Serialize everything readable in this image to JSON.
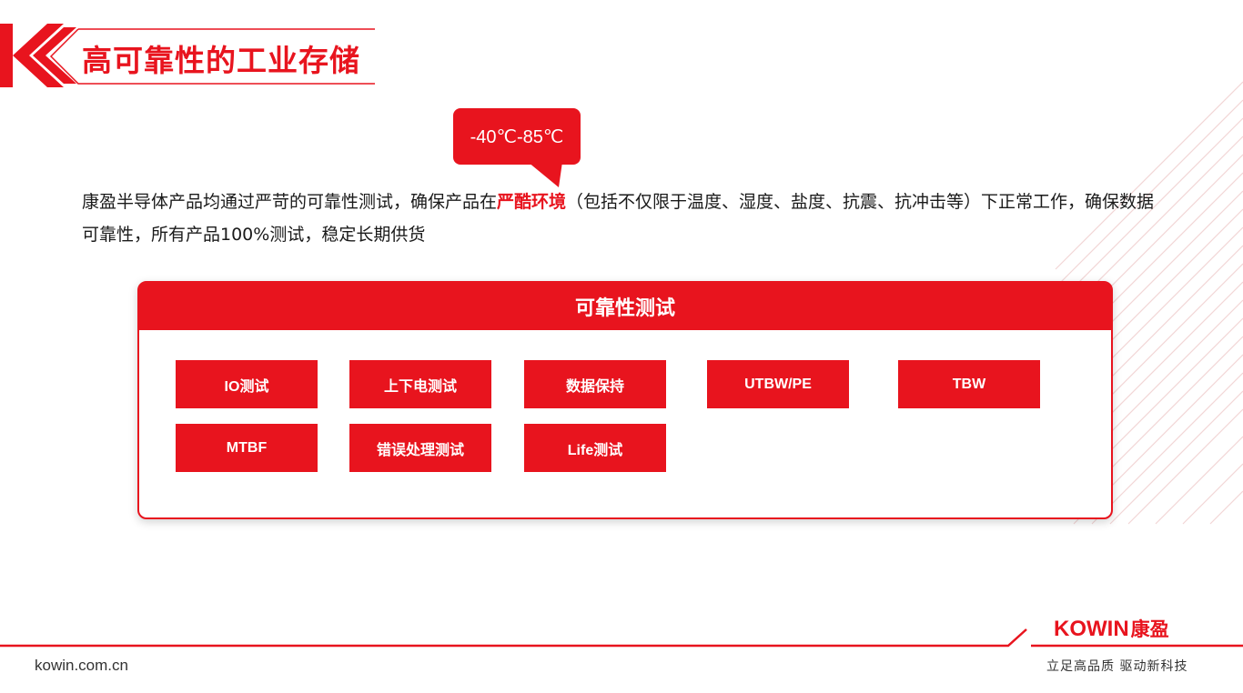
{
  "header": {
    "title": "高可靠性的工业存储"
  },
  "callout": {
    "text": "-40℃-85℃"
  },
  "intro": {
    "before": "康盈半导体产品均通过严苛的可靠性测试，确保产品在",
    "highlight": "严酷环境",
    "after": "（包括不仅限于温度、湿度、盐度、抗震、抗冲击等）下正常工作，确保数据可靠性，所有产品100%测试，稳定长期供货"
  },
  "panel": {
    "title": "可靠性测试",
    "tests": [
      "IO测试",
      "上下电测试",
      "数据保持",
      "UTBW/PE",
      "TBW",
      "MTBF",
      "错误处理测试",
      "Life测试"
    ]
  },
  "footer": {
    "brand_name": "KOWIN",
    "brand_cn": "康盈",
    "website": "kowin.com.cn",
    "slogan": "立足高品质 驱动新科技"
  },
  "colors": {
    "accent": "#e8141e",
    "text": "#1a1a1a"
  }
}
